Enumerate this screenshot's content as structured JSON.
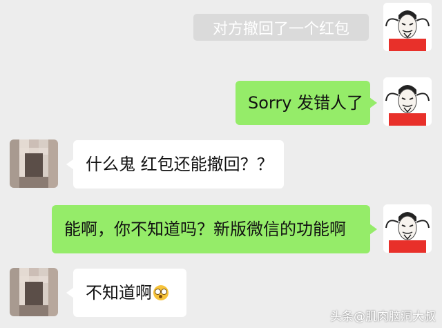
{
  "notice": {
    "recalled_text": "对方撤回了一个红包"
  },
  "messages": [
    {
      "side": "right",
      "text": "Sorry 发错人了"
    },
    {
      "side": "left",
      "text": "什么鬼 红包还能撤回？？"
    },
    {
      "side": "right",
      "text": "能啊，你不知道吗？新版微信的功能啊"
    },
    {
      "side": "left",
      "text": "不知道啊",
      "emoji": "astonished-face-emoji"
    }
  ],
  "watermark": {
    "text": "头条@肌肉脑洞大叔"
  },
  "colors": {
    "background": "#ededed",
    "sent_bubble": "#95ec69",
    "received_bubble": "#ffffff",
    "notice_bg": "#dadada"
  }
}
